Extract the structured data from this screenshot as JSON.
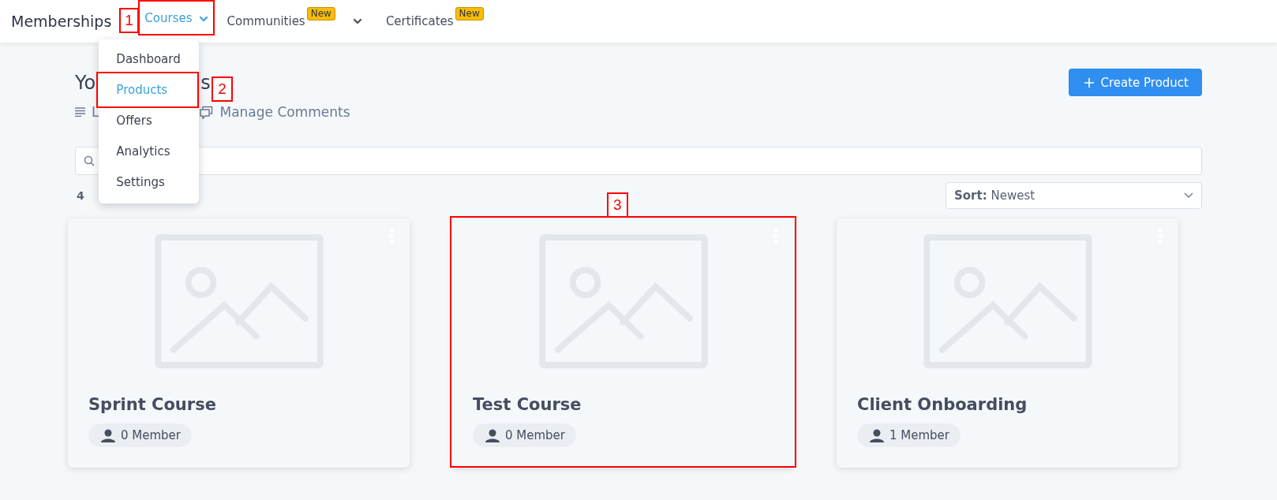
{
  "app_title": "Memberships",
  "nav": [
    {
      "label": "Courses",
      "kind": "menu",
      "selected": true,
      "expanded": true,
      "annotation": "1",
      "menu_items": [
        {
          "label": "Dashboard",
          "selected": false
        },
        {
          "label": "Products",
          "selected": true,
          "annotation": "2"
        },
        {
          "label": "Offers",
          "selected": false
        },
        {
          "label": "Analytics",
          "selected": false
        },
        {
          "label": "Settings",
          "selected": false
        }
      ]
    },
    {
      "label": "Communities",
      "kind": "menu",
      "selected": false,
      "badge": "New"
    },
    {
      "label": "Certificates",
      "kind": "link",
      "selected": false,
      "badge": "New"
    }
  ],
  "heading": {
    "start": "Yo",
    "end": "s"
  },
  "create_button": "Create Product",
  "links": [
    {
      "label": "L",
      "kind": "list"
    },
    {
      "label": "Manage Comments",
      "kind": "comments"
    }
  ],
  "count": "4",
  "sort": {
    "label": "Sort:",
    "value": "Newest"
  },
  "cards": [
    {
      "title": "Sprint Course",
      "members": "0 Member"
    },
    {
      "title": "Test Course",
      "members": "0 Member",
      "annotation": "3"
    },
    {
      "title": "Client Onboarding",
      "members": "1 Member"
    }
  ]
}
